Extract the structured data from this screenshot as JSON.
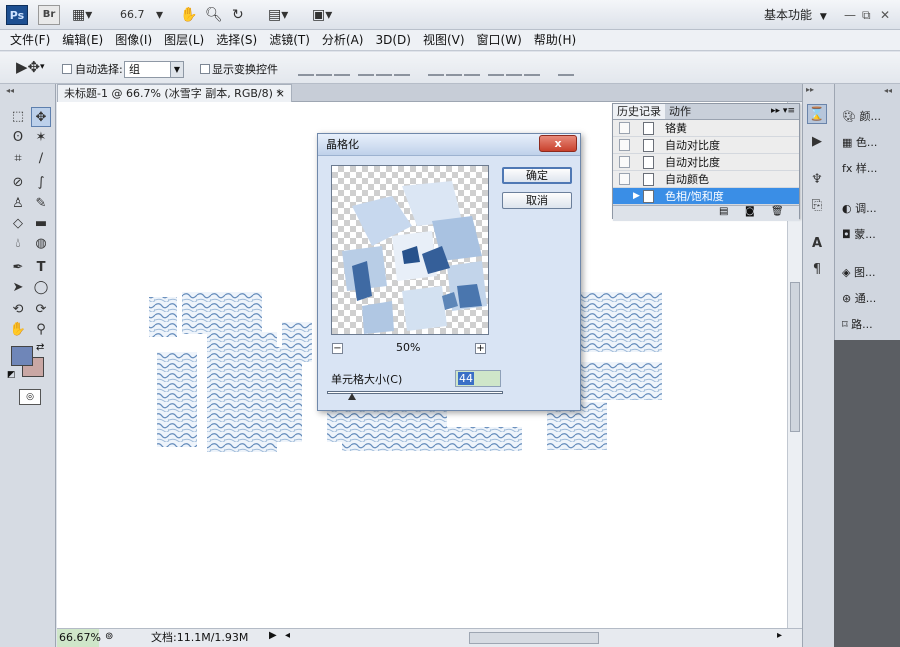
{
  "app": {
    "ps_logo": "Ps",
    "br_logo": "Br",
    "zoom": "66.7",
    "workspace": "基本功能",
    "workspace_arrow": "▼"
  },
  "menu": [
    "文件(F)",
    "编辑(E)",
    "图像(I)",
    "图层(L)",
    "选择(S)",
    "滤镜(T)",
    "分析(A)",
    "3D(D)",
    "视图(V)",
    "窗口(W)",
    "帮助(H)"
  ],
  "options": {
    "auto_select_label": "自动选择:",
    "auto_select_value": "组",
    "show_transform_label": "显示变换控件"
  },
  "document": {
    "tab_title": "未标题-1 @ 66.7% (冰雪字 副本, RGB/8) *",
    "close": "×"
  },
  "status": {
    "zoom": "66.67%",
    "doc_info": "文档:11.1M/1.93M"
  },
  "history_panel": {
    "tabs": [
      "历史记录",
      "动作"
    ],
    "rows": [
      {
        "label": "铬黄",
        "selected": false
      },
      {
        "label": "自动对比度",
        "selected": false
      },
      {
        "label": "自动对比度",
        "selected": false
      },
      {
        "label": "自动颜色",
        "selected": false
      },
      {
        "label": "色相/饱和度",
        "selected": true
      }
    ]
  },
  "right_panel": {
    "items": [
      "颜...",
      "色...",
      "样...",
      "调...",
      "蒙...",
      "图...",
      "通...",
      "路..."
    ]
  },
  "dialog": {
    "title": "晶格化",
    "close": "x",
    "ok": "确定",
    "cancel": "取消",
    "zoom_label": "50%",
    "zoom_minus": "−",
    "zoom_plus": "+",
    "cell_size_label": "单元格大小(C)",
    "cell_size_value": "44"
  },
  "colors": {
    "foreground": "#6f86b8",
    "background": "#c9a7a4",
    "selection_blue": "#3a8ee6",
    "dialog_bg": "#d9e4f4"
  }
}
